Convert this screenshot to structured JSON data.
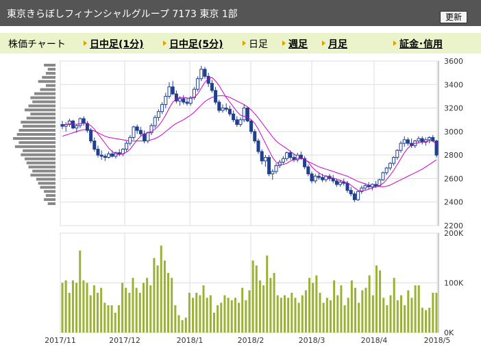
{
  "header": {
    "title": "東京きらぼしフィナンシャルグループ 7173 東京 1部",
    "refresh_label": "更新"
  },
  "nav": {
    "chart_label": "株価チャート",
    "intraday_1min": "日中足(1分)",
    "intraday_5min": "日中足(5分)",
    "daily": "日足",
    "weekly": "週足",
    "monthly": "月足",
    "margin": "証金･信用"
  },
  "colors": {
    "up_candle": "#ffffff",
    "down_candle": "#1f3f8f",
    "moving_average": "#cc00cc",
    "volume_bar": "#99b233",
    "volume_profile": "#888888",
    "title_bar": "#555555",
    "nav_bar": "#eaf3c9"
  },
  "chart_data": [
    {
      "type": "candlestick",
      "title": "",
      "ylim": [
        2200,
        3600
      ],
      "y_ticks": [
        "3600",
        "3400",
        "3200",
        "3000",
        "2800",
        "2600",
        "2400",
        "2200"
      ],
      "x_ticks": [
        "2017/11",
        "2017/12",
        "2018/1",
        "2018/2",
        "2018/3",
        "2018/4",
        "2018/5"
      ],
      "grid": true,
      "ohlc": [
        [
          3060,
          3090,
          3020,
          3045
        ],
        [
          3045,
          3080,
          3000,
          3060
        ],
        [
          3060,
          3110,
          3040,
          3090
        ],
        [
          3090,
          3100,
          3020,
          3030
        ],
        [
          3030,
          3060,
          2990,
          3050
        ],
        [
          3050,
          3120,
          3030,
          3110
        ],
        [
          3110,
          3130,
          3050,
          3070
        ],
        [
          3070,
          3090,
          2990,
          3010
        ],
        [
          3010,
          3030,
          2900,
          2920
        ],
        [
          2920,
          2950,
          2830,
          2850
        ],
        [
          2850,
          2880,
          2780,
          2800
        ],
        [
          2800,
          2840,
          2760,
          2790
        ],
        [
          2790,
          2810,
          2750,
          2780
        ],
        [
          2780,
          2830,
          2770,
          2810
        ],
        [
          2810,
          2840,
          2780,
          2790
        ],
        [
          2790,
          2830,
          2770,
          2820
        ],
        [
          2820,
          2850,
          2790,
          2810
        ],
        [
          2810,
          2860,
          2790,
          2850
        ],
        [
          2850,
          2920,
          2830,
          2900
        ],
        [
          2900,
          2970,
          2880,
          2950
        ],
        [
          2950,
          3050,
          2930,
          3040
        ],
        [
          3040,
          3060,
          2980,
          3010
        ],
        [
          3010,
          3040,
          2960,
          2980
        ],
        [
          2980,
          3010,
          2900,
          2920
        ],
        [
          2920,
          3000,
          2900,
          2990
        ],
        [
          2990,
          3070,
          2970,
          3050
        ],
        [
          3050,
          3140,
          3030,
          3120
        ],
        [
          3120,
          3190,
          3090,
          3170
        ],
        [
          3170,
          3250,
          3150,
          3230
        ],
        [
          3230,
          3330,
          3200,
          3300
        ],
        [
          3300,
          3420,
          3280,
          3380
        ],
        [
          3380,
          3430,
          3310,
          3320
        ],
        [
          3320,
          3350,
          3240,
          3260
        ],
        [
          3260,
          3300,
          3220,
          3280
        ],
        [
          3280,
          3310,
          3230,
          3250
        ],
        [
          3250,
          3290,
          3220,
          3240
        ],
        [
          3240,
          3300,
          3220,
          3290
        ],
        [
          3290,
          3380,
          3270,
          3360
        ],
        [
          3360,
          3470,
          3340,
          3450
        ],
        [
          3450,
          3560,
          3430,
          3530
        ],
        [
          3530,
          3550,
          3450,
          3470
        ],
        [
          3470,
          3500,
          3380,
          3410
        ],
        [
          3410,
          3440,
          3330,
          3350
        ],
        [
          3350,
          3380,
          3230,
          3250
        ],
        [
          3250,
          3270,
          3160,
          3180
        ],
        [
          3180,
          3230,
          3160,
          3200
        ],
        [
          3200,
          3240,
          3170,
          3190
        ],
        [
          3190,
          3220,
          3130,
          3150
        ],
        [
          3150,
          3180,
          3080,
          3100
        ],
        [
          3100,
          3130,
          3040,
          3060
        ],
        [
          3060,
          3120,
          3040,
          3100
        ],
        [
          3100,
          3230,
          3080,
          3200
        ],
        [
          3200,
          3210,
          3080,
          3090
        ],
        [
          3090,
          3100,
          2980,
          3000
        ],
        [
          3000,
          3020,
          2900,
          2920
        ],
        [
          2920,
          2940,
          2810,
          2830
        ],
        [
          2830,
          2850,
          2720,
          2750
        ],
        [
          2750,
          2800,
          2700,
          2780
        ],
        [
          2780,
          2800,
          2620,
          2640
        ],
        [
          2640,
          2680,
          2590,
          2660
        ],
        [
          2660,
          2730,
          2640,
          2710
        ],
        [
          2710,
          2760,
          2690,
          2740
        ],
        [
          2740,
          2790,
          2720,
          2770
        ],
        [
          2770,
          2830,
          2750,
          2820
        ],
        [
          2820,
          2840,
          2760,
          2780
        ],
        [
          2780,
          2810,
          2740,
          2760
        ],
        [
          2760,
          2820,
          2740,
          2800
        ],
        [
          2800,
          2830,
          2760,
          2770
        ],
        [
          2770,
          2790,
          2680,
          2700
        ],
        [
          2700,
          2720,
          2620,
          2640
        ],
        [
          2640,
          2660,
          2560,
          2580
        ],
        [
          2580,
          2640,
          2560,
          2620
        ],
        [
          2620,
          2650,
          2590,
          2610
        ],
        [
          2610,
          2640,
          2570,
          2590
        ],
        [
          2590,
          2630,
          2570,
          2620
        ],
        [
          2620,
          2640,
          2580,
          2600
        ],
        [
          2600,
          2630,
          2560,
          2580
        ],
        [
          2580,
          2600,
          2530,
          2550
        ],
        [
          2550,
          2590,
          2530,
          2570
        ],
        [
          2570,
          2600,
          2540,
          2560
        ],
        [
          2560,
          2580,
          2480,
          2500
        ],
        [
          2500,
          2530,
          2450,
          2470
        ],
        [
          2470,
          2490,
          2400,
          2420
        ],
        [
          2420,
          2500,
          2410,
          2490
        ],
        [
          2490,
          2540,
          2470,
          2520
        ],
        [
          2520,
          2560,
          2500,
          2540
        ],
        [
          2540,
          2570,
          2510,
          2530
        ],
        [
          2530,
          2560,
          2500,
          2550
        ],
        [
          2550,
          2580,
          2520,
          2540
        ],
        [
          2540,
          2600,
          2530,
          2590
        ],
        [
          2590,
          2660,
          2580,
          2650
        ],
        [
          2650,
          2700,
          2630,
          2690
        ],
        [
          2690,
          2740,
          2670,
          2730
        ],
        [
          2730,
          2790,
          2710,
          2780
        ],
        [
          2780,
          2850,
          2760,
          2840
        ],
        [
          2840,
          2920,
          2820,
          2900
        ],
        [
          2900,
          2960,
          2870,
          2930
        ],
        [
          2930,
          2950,
          2880,
          2900
        ],
        [
          2900,
          2940,
          2860,
          2880
        ],
        [
          2880,
          2930,
          2860,
          2920
        ],
        [
          2920,
          2960,
          2900,
          2940
        ],
        [
          2940,
          2960,
          2890,
          2910
        ],
        [
          2910,
          2950,
          2880,
          2930
        ],
        [
          2930,
          2960,
          2900,
          2950
        ],
        [
          2950,
          2970,
          2910,
          2920
        ],
        [
          2920,
          2930,
          2780,
          2800
        ]
      ],
      "ma_short": [
        3050,
        3060,
        3065,
        3065,
        3062,
        3068,
        3072,
        3068,
        3050,
        3020,
        2980,
        2940,
        2900,
        2860,
        2830,
        2810,
        2805,
        2810,
        2825,
        2850,
        2890,
        2930,
        2960,
        2980,
        2990,
        3000,
        3020,
        3050,
        3090,
        3140,
        3200,
        3250,
        3280,
        3290,
        3290,
        3285,
        3280,
        3290,
        3320,
        3370,
        3420,
        3450,
        3460,
        3430,
        3390,
        3340,
        3290,
        3250,
        3210,
        3170,
        3140,
        3130,
        3120,
        3100,
        3070,
        3020,
        2960,
        2900,
        2840,
        2780,
        2740,
        2720,
        2720,
        2730,
        2750,
        2760,
        2770,
        2775,
        2765,
        2740,
        2700,
        2670,
        2650,
        2630,
        2620,
        2610,
        2605,
        2595,
        2585,
        2575,
        2565,
        2545,
        2520,
        2500,
        2495,
        2500,
        2510,
        2520,
        2530,
        2540,
        2560,
        2590,
        2630,
        2670,
        2720,
        2770,
        2820,
        2860,
        2885,
        2900,
        2905,
        2910,
        2915,
        2920,
        2920,
        2890
      ],
      "ma_long": [
        2960,
        2970,
        2980,
        2990,
        3000,
        3010,
        3015,
        3018,
        3015,
        3005,
        2990,
        2975,
        2960,
        2950,
        2945,
        2940,
        2935,
        2930,
        2925,
        2920,
        2920,
        2920,
        2920,
        2920,
        2925,
        2930,
        2940,
        2955,
        2975,
        3000,
        3025,
        3050,
        3070,
        3085,
        3100,
        3120,
        3140,
        3165,
        3195,
        3225,
        3255,
        3275,
        3290,
        3300,
        3305,
        3305,
        3300,
        3290,
        3275,
        3260,
        3245,
        3230,
        3210,
        3185,
        3150,
        3115,
        3075,
        3035,
        2995,
        2955,
        2920,
        2895,
        2875,
        2855,
        2830,
        2810,
        2790,
        2775,
        2760,
        2745,
        2730,
        2715,
        2700,
        2690,
        2680,
        2670,
        2660,
        2650,
        2640,
        2630,
        2620,
        2605,
        2590,
        2575,
        2565,
        2555,
        2545,
        2540,
        2535,
        2532,
        2530,
        2535,
        2545,
        2560,
        2575,
        2590,
        2605,
        2620,
        2635,
        2650,
        2665,
        2680,
        2700,
        2720,
        2740,
        2760
      ]
    },
    {
      "type": "bar",
      "title": "",
      "ylim": [
        0,
        200000
      ],
      "y_ticks": [
        "200K",
        "100K",
        "0K"
      ],
      "values": [
        100000,
        105000,
        80000,
        105000,
        100000,
        165000,
        105000,
        100000,
        75000,
        95000,
        80000,
        90000,
        60000,
        55000,
        55000,
        40000,
        55000,
        100000,
        90000,
        80000,
        110000,
        90000,
        80000,
        100000,
        110000,
        95000,
        150000,
        135000,
        175000,
        145000,
        120000,
        110000,
        55000,
        35000,
        25000,
        30000,
        80000,
        70000,
        80000,
        75000,
        95000,
        70000,
        75000,
        40000,
        55000,
        60000,
        75000,
        70000,
        65000,
        70000,
        60000,
        90000,
        65000,
        85000,
        145000,
        135000,
        105000,
        95000,
        155000,
        110000,
        120000,
        75000,
        70000,
        75000,
        70000,
        80000,
        70000,
        60000,
        75000,
        85000,
        110000,
        100000,
        115000,
        80000,
        60000,
        70000,
        65000,
        105000,
        75000,
        95000,
        55000,
        70000,
        105000,
        90000,
        60000,
        85000,
        90000,
        115000,
        75000,
        135000,
        125000,
        70000,
        55000,
        75000,
        110000,
        65000,
        75000,
        55000,
        85000,
        70000,
        95000,
        95000,
        50000,
        45000,
        50000,
        80000,
        80000
      ]
    },
    {
      "type": "bar",
      "title": "",
      "categories": "price_bands",
      "values": [
        6,
        4,
        5,
        7,
        9,
        5,
        8,
        11,
        13,
        12,
        14,
        16,
        13,
        15,
        18,
        17,
        19,
        20,
        22,
        19,
        21,
        17,
        18,
        16,
        15,
        14,
        12,
        13,
        10,
        9,
        8,
        6,
        5,
        6,
        4
      ]
    }
  ]
}
